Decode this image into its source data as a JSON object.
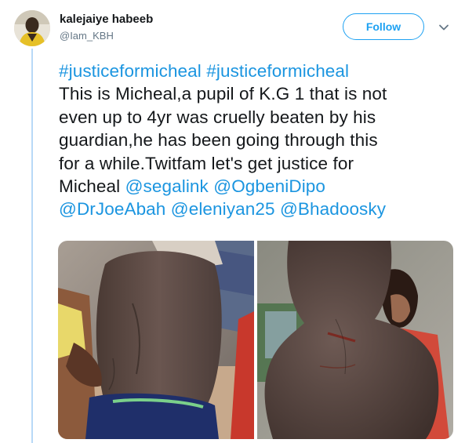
{
  "tweet": {
    "author_name": "kalejaiye habeeb",
    "author_handle": "@Iam_KBH",
    "follow_label": "Follow",
    "lines": [
      [
        {
          "text": "#justiceformicheal",
          "link": true
        },
        {
          "text": " ",
          "link": false
        },
        {
          "text": "#justiceformicheal",
          "link": true
        }
      ],
      [
        {
          "text": "This is Micheal,a pupil of K.G 1 that is not",
          "link": false
        }
      ],
      [
        {
          "text": "even up to 4yr was cruelly beaten by his",
          "link": false
        }
      ],
      [
        {
          "text": "guardian,he has been going through this",
          "link": false
        }
      ],
      [
        {
          "text": "for a while.Twitfam let's get justice for",
          "link": false
        }
      ],
      [
        {
          "text": "Micheal  ",
          "link": false
        },
        {
          "text": "@segalink",
          "link": true
        },
        {
          "text": " ",
          "link": false
        },
        {
          "text": "@OgbeniDipo",
          "link": true
        }
      ],
      [
        {
          "text": "@DrJoeAbah",
          "link": true
        },
        {
          "text": " ",
          "link": false
        },
        {
          "text": "@eleniyan25",
          "link": true
        },
        {
          "text": " ",
          "link": false
        },
        {
          "text": "@Bhadoosky",
          "link": true
        }
      ]
    ]
  },
  "colors": {
    "link": "#1b95e0",
    "accent": "#1da1f2",
    "text": "#14171a",
    "secondary": "#657786",
    "thread_line": "#b8d9f7"
  },
  "icons": {
    "menu": "chevron-down-icon"
  },
  "media": {
    "count": 2
  }
}
